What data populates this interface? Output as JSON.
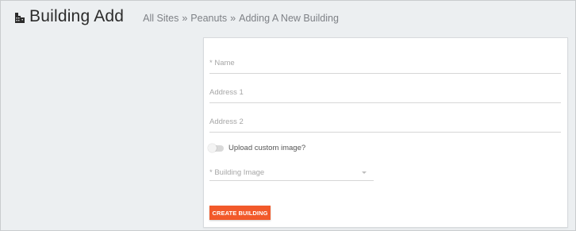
{
  "header": {
    "title": "Building Add",
    "icon": "building-icon"
  },
  "breadcrumb": {
    "items": [
      "All Sites",
      "Peanuts",
      "Adding A New Building"
    ],
    "separator": "»"
  },
  "form": {
    "name_placeholder": "* Name",
    "address1_placeholder": "Address 1",
    "address2_placeholder": "Address 2",
    "upload_toggle_label": "Upload custom image?",
    "building_image_placeholder": "* Building Image",
    "submit_label": "CREATE BUILDING"
  },
  "colors": {
    "accent": "#f2592a",
    "page_background": "#eceff1",
    "card_background": "#ffffff"
  }
}
